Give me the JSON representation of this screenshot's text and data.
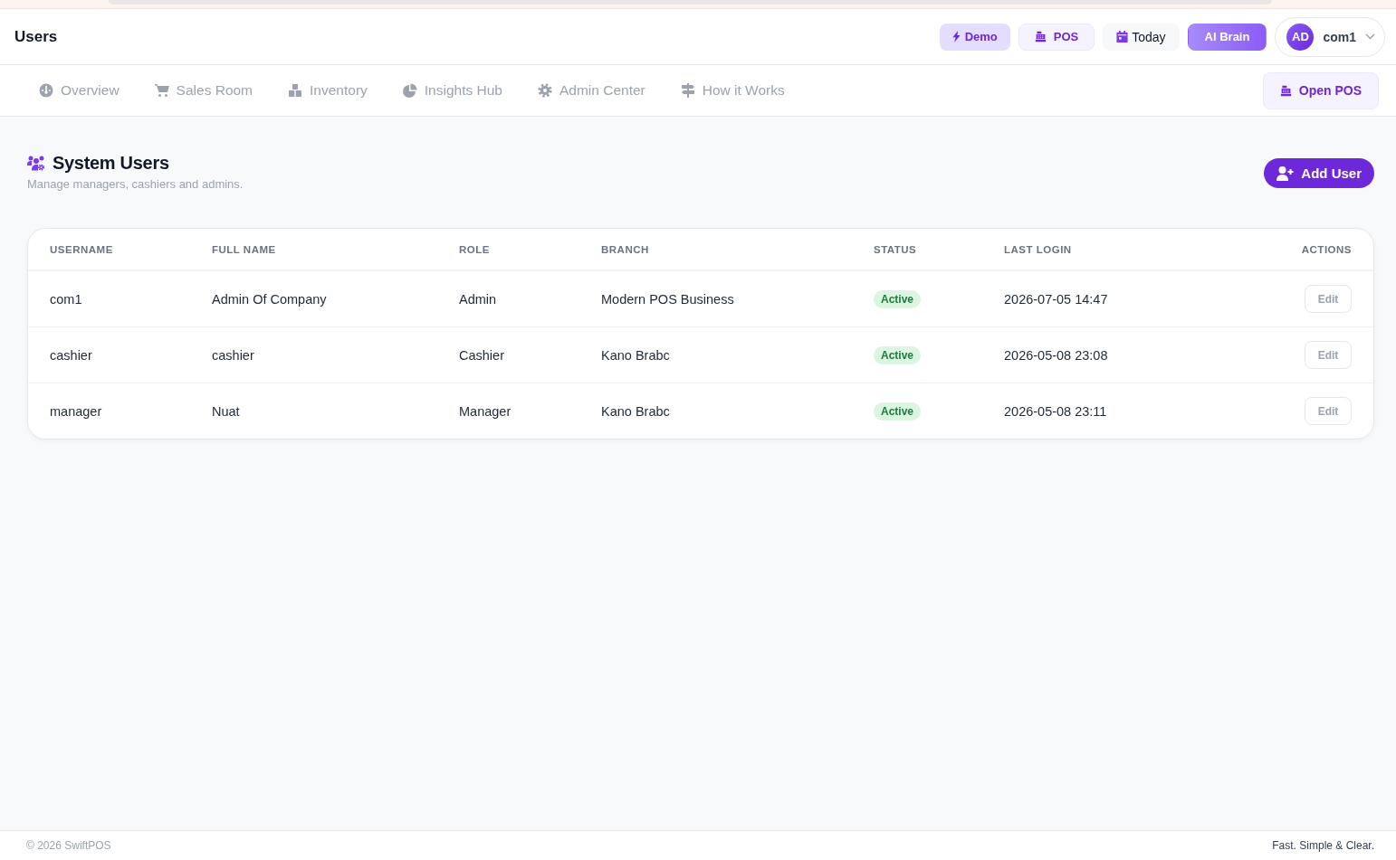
{
  "header": {
    "title": "Users",
    "actions": [
      {
        "kind": "demo",
        "label": "Demo"
      },
      {
        "kind": "pos",
        "label": "POS"
      },
      {
        "kind": "today",
        "label": "Today"
      },
      {
        "kind": "ai",
        "label": "AI Brain"
      }
    ],
    "user": {
      "initials": "AD",
      "name": "com1"
    }
  },
  "nav": {
    "tabs": [
      {
        "label": "Overview",
        "selected": false
      },
      {
        "label": "Sales Room",
        "selected": false
      },
      {
        "label": "Inventory",
        "selected": false
      },
      {
        "label": "Insights Hub",
        "selected": false
      },
      {
        "label": "Admin Center",
        "selected": false
      },
      {
        "label": "How it Works",
        "selected": false
      }
    ],
    "open_pos_button": "Open POS"
  },
  "page": {
    "title": "System Users",
    "subtitle": "Manage managers, cashiers and admins.",
    "add_button": "Add User"
  },
  "table": {
    "columns": [
      "USERNAME",
      "FULL NAME",
      "ROLE",
      "BRANCH",
      "STATUS",
      "LAST LOGIN",
      "ACTIONS"
    ],
    "rows": [
      {
        "username": "com1",
        "full_name": "Admin Of Company",
        "role": "Admin",
        "branch": "Modern POS Business",
        "status": "Active",
        "last_login": "2026-07-05 14:47",
        "action": "Edit"
      },
      {
        "username": "cashier",
        "full_name": "cashier",
        "role": "Cashier",
        "branch": "Kano Brabc",
        "status": "Active",
        "last_login": "2026-05-08 23:08",
        "action": "Edit"
      },
      {
        "username": "manager",
        "full_name": "Nuat",
        "role": "Manager",
        "branch": "Kano Brabc",
        "status": "Active",
        "last_login": "2026-05-08 23:11",
        "action": "Edit"
      }
    ]
  },
  "footer": {
    "copyright": "© 2026 SwiftPOS",
    "tagline": "Fast. Simple & Clear."
  }
}
